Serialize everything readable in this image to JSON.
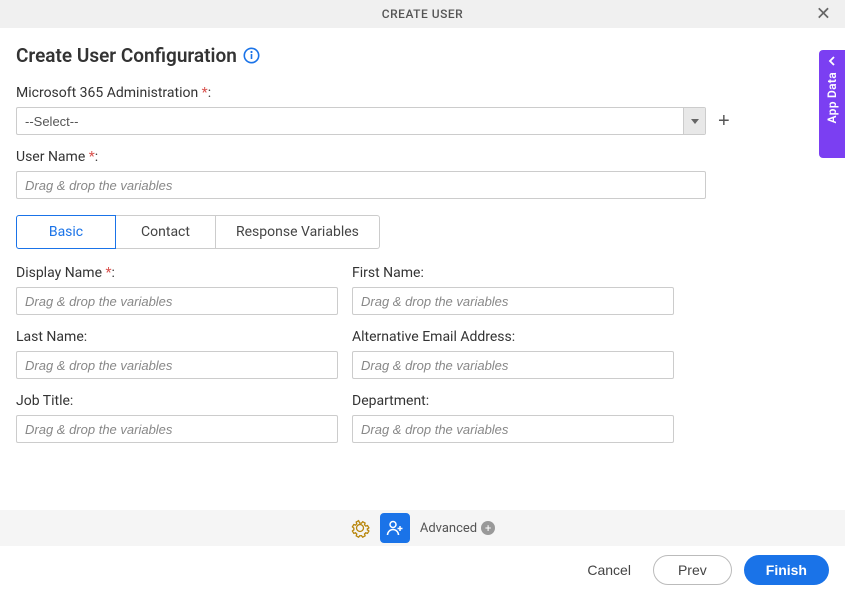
{
  "header": {
    "title": "CREATE USER"
  },
  "page": {
    "title": "Create User Configuration"
  },
  "fields": {
    "admin": {
      "label": "Microsoft 365 Administration ",
      "req": "*",
      "selected": "--Select--"
    },
    "username": {
      "label": "User Name ",
      "req": "*",
      "placeholder": "Drag & drop the variables"
    },
    "displayName": {
      "label": "Display Name ",
      "req": "*",
      "placeholder": "Drag & drop the variables"
    },
    "firstName": {
      "label": "First Name:",
      "placeholder": "Drag & drop the variables"
    },
    "lastName": {
      "label": "Last Name:",
      "placeholder": "Drag & drop the variables"
    },
    "altEmail": {
      "label": "Alternative Email Address:",
      "placeholder": "Drag & drop the variables"
    },
    "jobTitle": {
      "label": "Job Title:",
      "placeholder": "Drag & drop the variables"
    },
    "department": {
      "label": "Department:",
      "placeholder": "Drag & drop the variables"
    }
  },
  "tabs": {
    "basic": "Basic",
    "contact": "Contact",
    "response": "Response Variables"
  },
  "bottom": {
    "advanced": "Advanced"
  },
  "footer": {
    "cancel": "Cancel",
    "prev": "Prev",
    "finish": "Finish"
  },
  "sidetab": {
    "label": "App Data"
  }
}
